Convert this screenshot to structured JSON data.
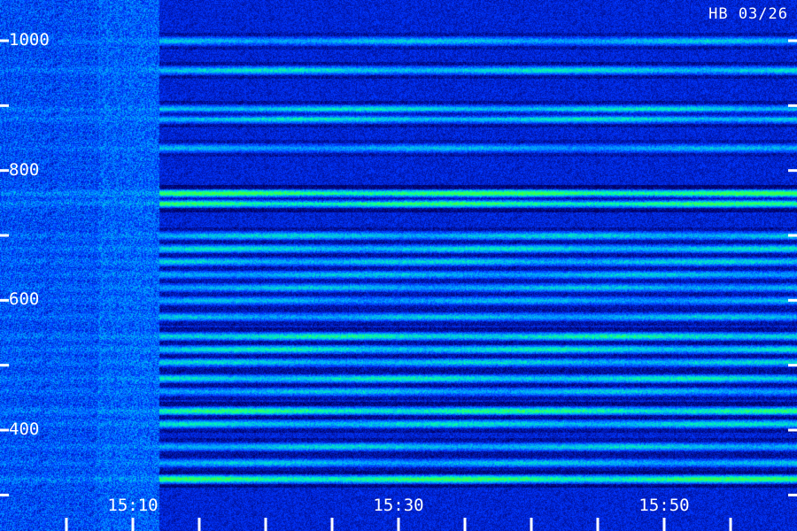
{
  "station_label": "HB 03/26",
  "chart_data": {
    "type": "heatmap",
    "title": "",
    "xlabel": "",
    "ylabel": "",
    "x_ticks": [
      "15:10",
      "15:30",
      "15:50"
    ],
    "y_ticks": [
      1000,
      800,
      600,
      400
    ],
    "y_range": [
      300,
      1050
    ],
    "signal_onset_time": "15:13",
    "bands": [
      {
        "freq": 1000,
        "intensity": 0.45
      },
      {
        "freq": 955,
        "intensity": 0.55
      },
      {
        "freq": 895,
        "intensity": 0.55
      },
      {
        "freq": 880,
        "intensity": 0.55
      },
      {
        "freq": 835,
        "intensity": 0.4
      },
      {
        "freq": 765,
        "intensity": 0.95
      },
      {
        "freq": 750,
        "intensity": 0.85
      },
      {
        "freq": 700,
        "intensity": 0.5
      },
      {
        "freq": 680,
        "intensity": 0.55
      },
      {
        "freq": 660,
        "intensity": 0.5
      },
      {
        "freq": 640,
        "intensity": 0.45
      },
      {
        "freq": 620,
        "intensity": 0.45
      },
      {
        "freq": 600,
        "intensity": 0.4
      },
      {
        "freq": 575,
        "intensity": 0.45
      },
      {
        "freq": 545,
        "intensity": 0.65
      },
      {
        "freq": 525,
        "intensity": 0.6
      },
      {
        "freq": 505,
        "intensity": 0.5
      },
      {
        "freq": 480,
        "intensity": 0.6
      },
      {
        "freq": 460,
        "intensity": 0.45
      },
      {
        "freq": 430,
        "intensity": 0.75
      },
      {
        "freq": 410,
        "intensity": 0.55
      },
      {
        "freq": 375,
        "intensity": 0.5
      },
      {
        "freq": 350,
        "intensity": 0.45
      },
      {
        "freq": 325,
        "intensity": 0.85
      }
    ],
    "colormap": [
      "#000060",
      "#0033ff",
      "#00aaff",
      "#00ffb0",
      "#40ff40"
    ]
  }
}
